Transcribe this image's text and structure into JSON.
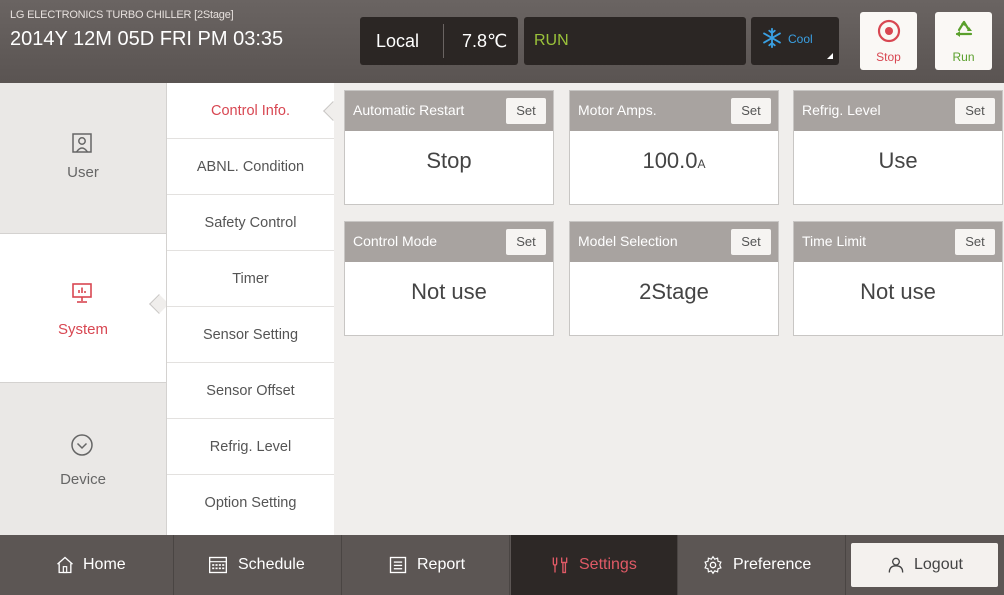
{
  "header": {
    "subtitle": "LG ELECTRONICS TURBO CHILLER [2Stage]",
    "datetime": "2014Y 12M 05D  FRI PM 03:35",
    "mode": "Local",
    "temperature": "7.8℃",
    "status": "RUN",
    "operation": "Cool",
    "stop_label": "Stop",
    "run_label": "Run"
  },
  "leftnav": {
    "user": "User",
    "system": "System",
    "device": "Device"
  },
  "submenu": [
    "Control Info.",
    "ABNL. Condition",
    "Safety Control",
    "Timer",
    "Sensor Setting",
    "Sensor Offset",
    "Refrig. Level",
    "Option Setting"
  ],
  "cards": [
    {
      "title": "Automatic Restart",
      "set": "Set",
      "value": "Stop",
      "unit": ""
    },
    {
      "title": "Motor Amps.",
      "set": "Set",
      "value": "100.0",
      "unit": "A"
    },
    {
      "title": "Refrig. Level",
      "set": "Set",
      "value": "Use",
      "unit": ""
    },
    {
      "title": "Control Mode",
      "set": "Set",
      "value": "Not use",
      "unit": ""
    },
    {
      "title": "Model Selection",
      "set": "Set",
      "value": "2Stage",
      "unit": ""
    },
    {
      "title": "Time Limit",
      "set": "Set",
      "value": "Not use",
      "unit": ""
    }
  ],
  "footer": {
    "home": "Home",
    "schedule": "Schedule",
    "report": "Report",
    "settings": "Settings",
    "preference": "Preference",
    "logout": "Logout"
  },
  "colors": {
    "accent_red": "#d84752",
    "run_green": "#9ac23a",
    "cool_blue": "#3aa0e3"
  }
}
